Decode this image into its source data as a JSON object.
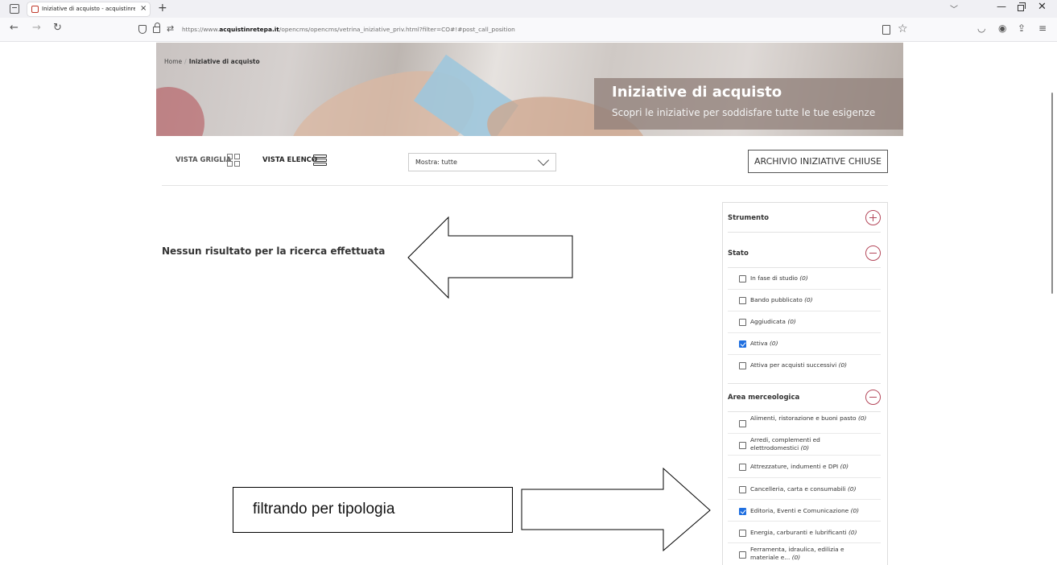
{
  "browser": {
    "tab_title": "Iniziative di acquisto - acquistinrete",
    "tab_close": "×",
    "new_tab": "+",
    "url_prefix": "https://www.",
    "url_domain": "acquistinretepa.it",
    "url_path": "/opencms/opencms/vetrina_iniziative_priv.html?filter=CO#!#post_call_position",
    "icons": [
      "tab-list-icon",
      "back-icon",
      "forward-icon",
      "reload-icon",
      "shield-icon",
      "lock-icon",
      "permissions-icon",
      "reader-view-icon",
      "bookmark-star-icon",
      "pocket-icon",
      "account-icon",
      "extensions-icon",
      "menu-icon"
    ]
  },
  "breadcrumb": {
    "home": "Home",
    "separator": "/",
    "current": "Iniziative di acquisto"
  },
  "hero": {
    "title": "Iniziative di acquisto",
    "subtitle": "Scopri le iniziative per soddisfare tutte le tue esigenze"
  },
  "toolbar": {
    "grid_view_label": "VISTA GRIGLIA",
    "list_view_label": "VISTA ELENCO",
    "show_select_value": "Mostra: tutte",
    "archive_button": "ARCHIVIO INIZIATIVE CHIUSE"
  },
  "results": {
    "empty_message": "Nessun risultato per la ricerca effettuata"
  },
  "annotation": {
    "text": "filtrando per tipologia"
  },
  "filters": {
    "accent_color": "#b4475a",
    "checkbox_color": "#1f6fe0",
    "sections": [
      {
        "title": "Strumento",
        "state": "collapsed",
        "options": []
      },
      {
        "title": "Stato",
        "state": "expanded",
        "options": [
          {
            "label": "In fase di studio",
            "count": "(0)",
            "checked": false
          },
          {
            "label": "Bando pubblicato",
            "count": "(0)",
            "checked": false
          },
          {
            "label": "Aggiudicata",
            "count": "(0)",
            "checked": false
          },
          {
            "label": "Attiva",
            "count": "(0)",
            "checked": true
          },
          {
            "label": "Attiva per acquisti successivi",
            "count": "(0)",
            "checked": false
          }
        ]
      },
      {
        "title": "Area merceologica",
        "state": "expanded",
        "options": [
          {
            "label": "Alimenti, ristorazione e buoni pasto",
            "count": "(0)",
            "checked": false
          },
          {
            "label": "Arredi, complementi ed elettrodomestici",
            "count": "(0)",
            "checked": false
          },
          {
            "label": "Attrezzature, indumenti e DPI",
            "count": "(0)",
            "checked": false
          },
          {
            "label": "Cancelleria, carta e consumabili",
            "count": "(0)",
            "checked": false
          },
          {
            "label": "Editoria, Eventi e Comunicazione",
            "count": "(0)",
            "checked": true
          },
          {
            "label": "Energia, carburanti e lubrificanti",
            "count": "(0)",
            "checked": false
          },
          {
            "label": "Ferramenta, idraulica, edilizia e materiale e...",
            "count": "(0)",
            "checked": false
          }
        ]
      }
    ]
  }
}
